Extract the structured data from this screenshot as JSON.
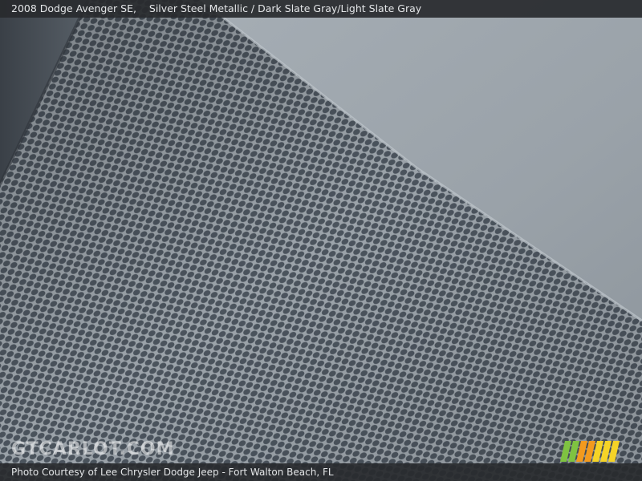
{
  "caption": {
    "vehicle": "2008 Dodge Avenger SE,",
    "colors": "Silver Steel Metallic / Dark Slate Gray/Light Slate Gray"
  },
  "credit": {
    "text": "Photo Courtesy of Lee Chrysler Dodge Jeep - Fort Walton Beach, FL"
  },
  "watermark": {
    "text": "GTCARLOT.COM"
  },
  "colors": {
    "bar_background": "#282a2e",
    "mesh_base": "#7f8890",
    "mesh_hole": "#4a535c",
    "fabric": "#9ea6ad",
    "logo_green": "#7fc241",
    "logo_orange": "#f39a1e",
    "logo_yellow": "#f5d327"
  }
}
